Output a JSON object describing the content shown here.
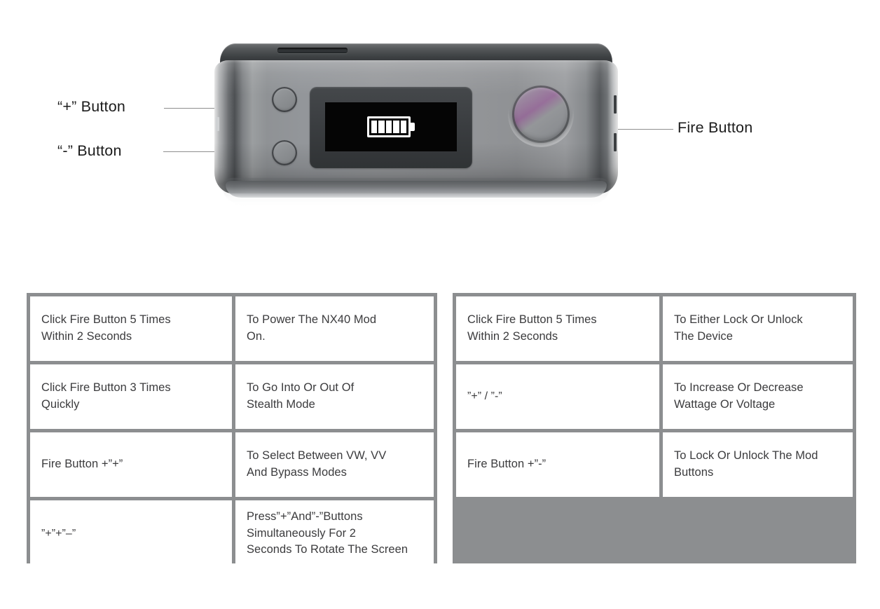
{
  "diagram": {
    "callouts": [
      {
        "id": "plus",
        "label": "“+” Button"
      },
      {
        "id": "minus",
        "label": "“-” Button"
      },
      {
        "id": "fire",
        "label": "Fire Button"
      }
    ],
    "device": {
      "name": "NX40 Mod",
      "screen": {
        "icon": "battery-icon",
        "battery_bars_filled": 5,
        "battery_bars_total": 5
      },
      "controls": [
        {
          "name": "plus-button",
          "label": "“+” Button"
        },
        {
          "name": "minus-button",
          "label": "“-” Button"
        },
        {
          "name": "fire-button",
          "label": "Fire Button"
        }
      ]
    }
  },
  "tables": {
    "left": {
      "rows": [
        {
          "action": "Click Fire Button 5 Times\nWithin 2 Seconds",
          "result": "To Power The NX40 Mod\nOn."
        },
        {
          "action": "Click Fire Button 3 Times\nQuickly",
          "result": "To Go Into Or Out Of\nStealth Mode"
        },
        {
          "action": "Fire Button +”+”",
          "result": "To Select Between VW, VV\nAnd Bypass Modes"
        },
        {
          "action": "”+”+”–”",
          "result": "Press”+”And”-”Buttons\nSimultaneously For 2\nSeconds To Rotate The Screen"
        }
      ]
    },
    "right": {
      "rows": [
        {
          "action": "Click Fire Button 5 Times\nWithin 2 Seconds",
          "result": "To Either Lock Or Unlock\n The Device"
        },
        {
          "action": "”+” / ”-”",
          "result": "To Increase Or Decrease\nWattage Or Voltage"
        },
        {
          "action": "Fire Button +”-”",
          "result": "To Lock Or Unlock The Mod\nButtons"
        }
      ]
    }
  },
  "colors": {
    "panel_gray": "#8c8e90",
    "cell_bg": "#ffffff",
    "text": "#3b3b3d",
    "label_text": "#1c1c1c",
    "leader_line": "#8e8e8e",
    "screen_bg": "#050505",
    "screen_fg": "#ffffff"
  }
}
